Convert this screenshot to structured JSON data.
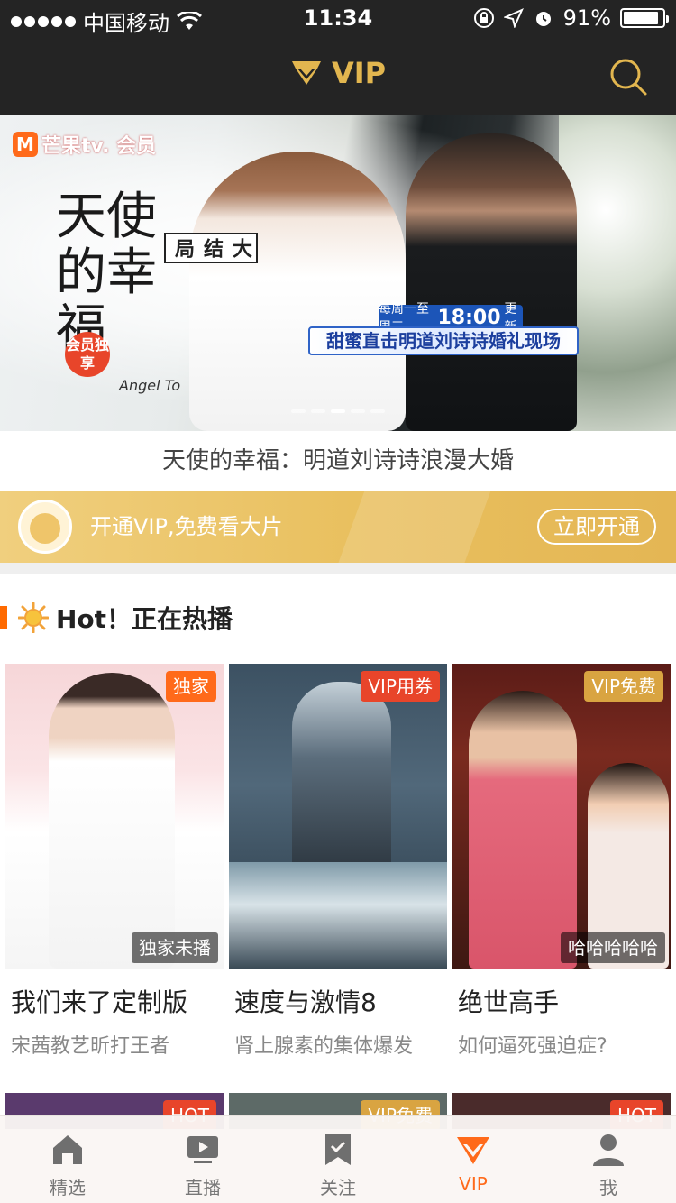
{
  "status_bar": {
    "carrier": "中国移动",
    "time": "11:34",
    "battery": "91%",
    "battery_level": 0.91
  },
  "nav": {
    "title": "VIP"
  },
  "banner": {
    "logo": "芒果tv. 会员",
    "calligraphy": [
      "天使",
      "的幸福"
    ],
    "angel_text": "Angel To",
    "finale_tag": "大结局",
    "vip_badge": "会员独享",
    "schedule_prefix": "每周一至周三",
    "schedule_time": "18:00",
    "schedule_suffix": "更新",
    "caption": "甜蜜直击明道刘诗诗婚礼现场",
    "title": "天使的幸福：明道刘诗诗浪漫大婚",
    "page_count": 5,
    "active_page": 3
  },
  "vip_promo": {
    "text": "开通VIP,免费看大片",
    "button": "立即开通"
  },
  "section": {
    "title": "Hot！正在热播"
  },
  "cards": [
    {
      "badge": "独家",
      "corner": "独家未播",
      "title": "我们来了定制版",
      "subtitle": "宋茜教艺昕打王者"
    },
    {
      "badge": "VIP用券",
      "corner": "",
      "title": "速度与激情8",
      "subtitle": "肾上腺素的集体爆发"
    },
    {
      "badge": "VIP免费",
      "corner": "哈哈哈哈哈",
      "title": "绝世高手",
      "subtitle": "如何逼死强迫症?"
    }
  ],
  "peek_badges": [
    "HOT",
    "VIP免费",
    "HOT"
  ],
  "tabs": [
    {
      "label": "精选",
      "icon": "home-icon"
    },
    {
      "label": "直播",
      "icon": "live-tv-icon"
    },
    {
      "label": "关注",
      "icon": "bookmark-icon"
    },
    {
      "label": "VIP",
      "icon": "vip-diamond-icon"
    },
    {
      "label": "我",
      "icon": "user-icon"
    }
  ],
  "colors": {
    "accent": "#ff6a1a",
    "gold": "#e2b64f",
    "dark_bar": "#242424"
  }
}
